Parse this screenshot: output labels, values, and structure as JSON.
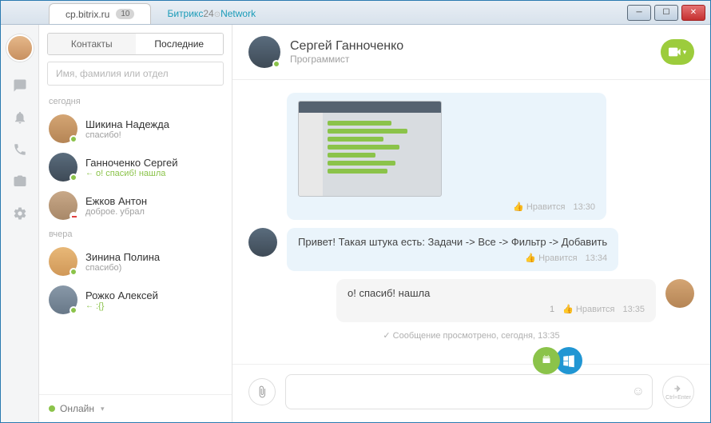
{
  "titlebar": {
    "tab1": "cp.bitrix.ru",
    "tab1_badge": "10",
    "tab2_a": "Битрикс",
    "tab2_b": "24",
    "tab2_c": "Network"
  },
  "sidebar": {
    "tab_contacts": "Контакты",
    "tab_recent": "Последние",
    "search_placeholder": "Имя, фамилия или отдел",
    "group_today": "сегодня",
    "group_yesterday": "вчера",
    "contacts": [
      {
        "name": "Шикина Надежда",
        "sub": "спасибо!",
        "reply": false
      },
      {
        "name": "Ганноченко Сергей",
        "sub": "о! спасиб! нашла",
        "reply": true
      },
      {
        "name": "Ежков Антон",
        "sub": "доброе. убрал",
        "reply": false
      },
      {
        "name": "Зинина Полина",
        "sub": "спасибо)",
        "reply": false
      },
      {
        "name": "Рожко Алексей",
        "sub": ":{}",
        "reply": true
      }
    ],
    "status": "Онлайн"
  },
  "chat": {
    "name": "Сергей Ганноченко",
    "role": "Программист",
    "messages": {
      "m1": {
        "like": "Нравится",
        "time": "13:30"
      },
      "m2": {
        "text": "Привет! Такая штука есть: Задачи -> Все -> Фильтр -> Добавить",
        "like": "Нравится",
        "time": "13:34"
      },
      "m3": {
        "text": "о! спасиб! нашла",
        "count": "1",
        "like": "Нравится",
        "time": "13:35"
      }
    },
    "read": "Сообщение просмотрено, сегодня, 13:35",
    "send_hint": "Ctrl+Enter"
  }
}
